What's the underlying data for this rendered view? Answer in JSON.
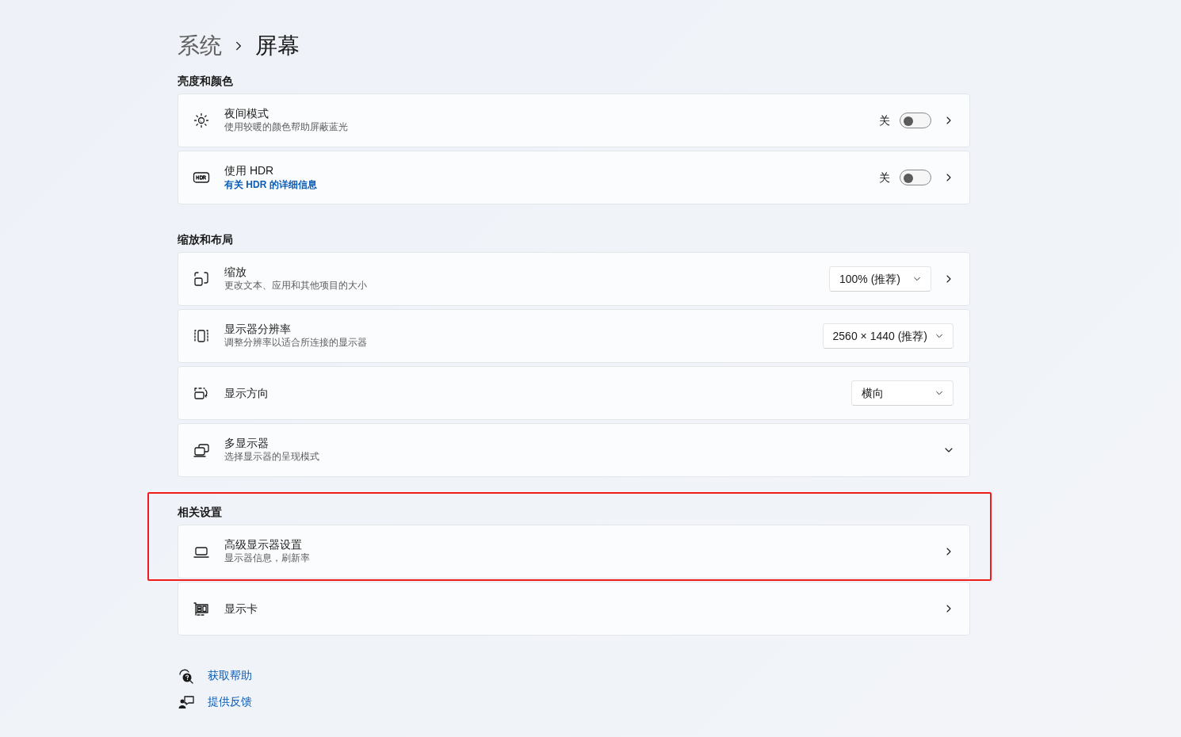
{
  "breadcrumb": [
    {
      "text": "系统",
      "selected": false
    },
    {
      "text": "屏幕",
      "selected": true
    }
  ],
  "sections": [
    {
      "heading": "亮度和颜色",
      "items": [
        {
          "kind": "sun",
          "title": "夜间模式",
          "subtitle": "使用较暖的颜色帮助屏蔽蓝光",
          "control": {
            "kind": "toggle",
            "label": "关",
            "on": false
          },
          "navigable": true,
          "expandable": false,
          "highlighted": false
        },
        {
          "kind": "hdr",
          "title": "使用 HDR",
          "link": "有关 HDR 的详细信息",
          "control": {
            "kind": "toggle",
            "label": "关",
            "on": false
          },
          "navigable": true,
          "expandable": false,
          "highlighted": false
        }
      ]
    },
    {
      "heading": "缩放和布局",
      "items": [
        {
          "kind": "scale",
          "title": "缩放",
          "subtitle": "更改文本、应用和其他项目的大小",
          "control": {
            "kind": "dropdown",
            "value": "100% (推荐)"
          },
          "navigable": true,
          "expandable": false,
          "highlighted": false
        },
        {
          "kind": "resolution",
          "title": "显示器分辨率",
          "subtitle": "调整分辨率以适合所连接的显示器",
          "control": {
            "kind": "dropdown",
            "value": "2560 × 1440 (推荐)"
          },
          "navigable": false,
          "expandable": false,
          "highlighted": false
        },
        {
          "kind": "rotate",
          "title": "显示方向",
          "control": {
            "kind": "dropdown",
            "value": "横向"
          },
          "navigable": false,
          "expandable": false,
          "highlighted": false
        },
        {
          "kind": "multi",
          "title": "多显示器",
          "subtitle": "选择显示器的呈现模式",
          "navigable": false,
          "expandable": true,
          "highlighted": false
        }
      ]
    },
    {
      "heading": "相关设置",
      "items": [
        {
          "kind": "laptop",
          "title": "高级显示器设置",
          "subtitle": "显示器信息，刷新率",
          "navigable": true,
          "expandable": false,
          "highlighted": true
        },
        {
          "kind": "gpu",
          "title": "显示卡",
          "navigable": true,
          "expandable": false,
          "highlighted": false
        }
      ]
    }
  ],
  "footer_links": [
    {
      "kind": "help",
      "text": "获取帮助"
    },
    {
      "kind": "feedback",
      "text": "提供反馈"
    }
  ]
}
